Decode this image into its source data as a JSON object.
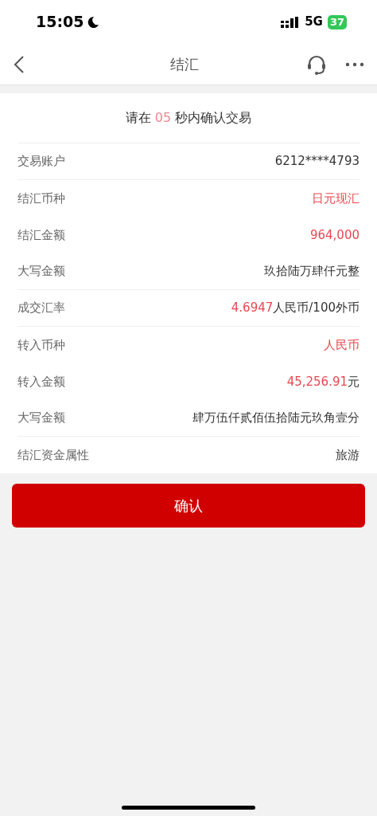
{
  "status_bar": {
    "time": "15:05",
    "network": "5G",
    "battery": "37"
  },
  "nav": {
    "title": "结汇"
  },
  "countdown": {
    "before": "请在",
    "seconds": "05",
    "after": "秒内确认交易"
  },
  "rows": [
    {
      "label": "交易账户",
      "value": [
        {
          "text": "6212****4793",
          "highlight": false
        }
      ],
      "divider": true
    },
    {
      "label": "结汇币种",
      "value": [
        {
          "text": "日元现汇",
          "highlight": true
        }
      ],
      "divider": false
    },
    {
      "label": "结汇金额",
      "value": [
        {
          "text": "964,000",
          "highlight": true
        }
      ],
      "divider": false
    },
    {
      "label": "大写金额",
      "value": [
        {
          "text": "玖拾陆万肆仟元整",
          "highlight": false
        }
      ],
      "divider": true
    },
    {
      "label": "成交汇率",
      "value": [
        {
          "text": "4.6947",
          "highlight": true
        },
        {
          "text": "人民币/100外币",
          "highlight": false
        }
      ],
      "divider": true
    },
    {
      "label": "转入币种",
      "value": [
        {
          "text": "人民币",
          "highlight": true
        }
      ],
      "divider": false
    },
    {
      "label": "转入金额",
      "value": [
        {
          "text": "45,256.91",
          "highlight": true
        },
        {
          "text": "元",
          "highlight": false
        }
      ],
      "divider": false
    },
    {
      "label": "大写金额",
      "value": [
        {
          "text": "肆万伍仟贰佰伍拾陆元玖角壹分",
          "highlight": false
        }
      ],
      "divider": true
    },
    {
      "label": "结汇资金属性",
      "value": [
        {
          "text": "旅游",
          "highlight": false
        }
      ],
      "divider": false
    }
  ],
  "confirm_button": {
    "label": "确认"
  }
}
